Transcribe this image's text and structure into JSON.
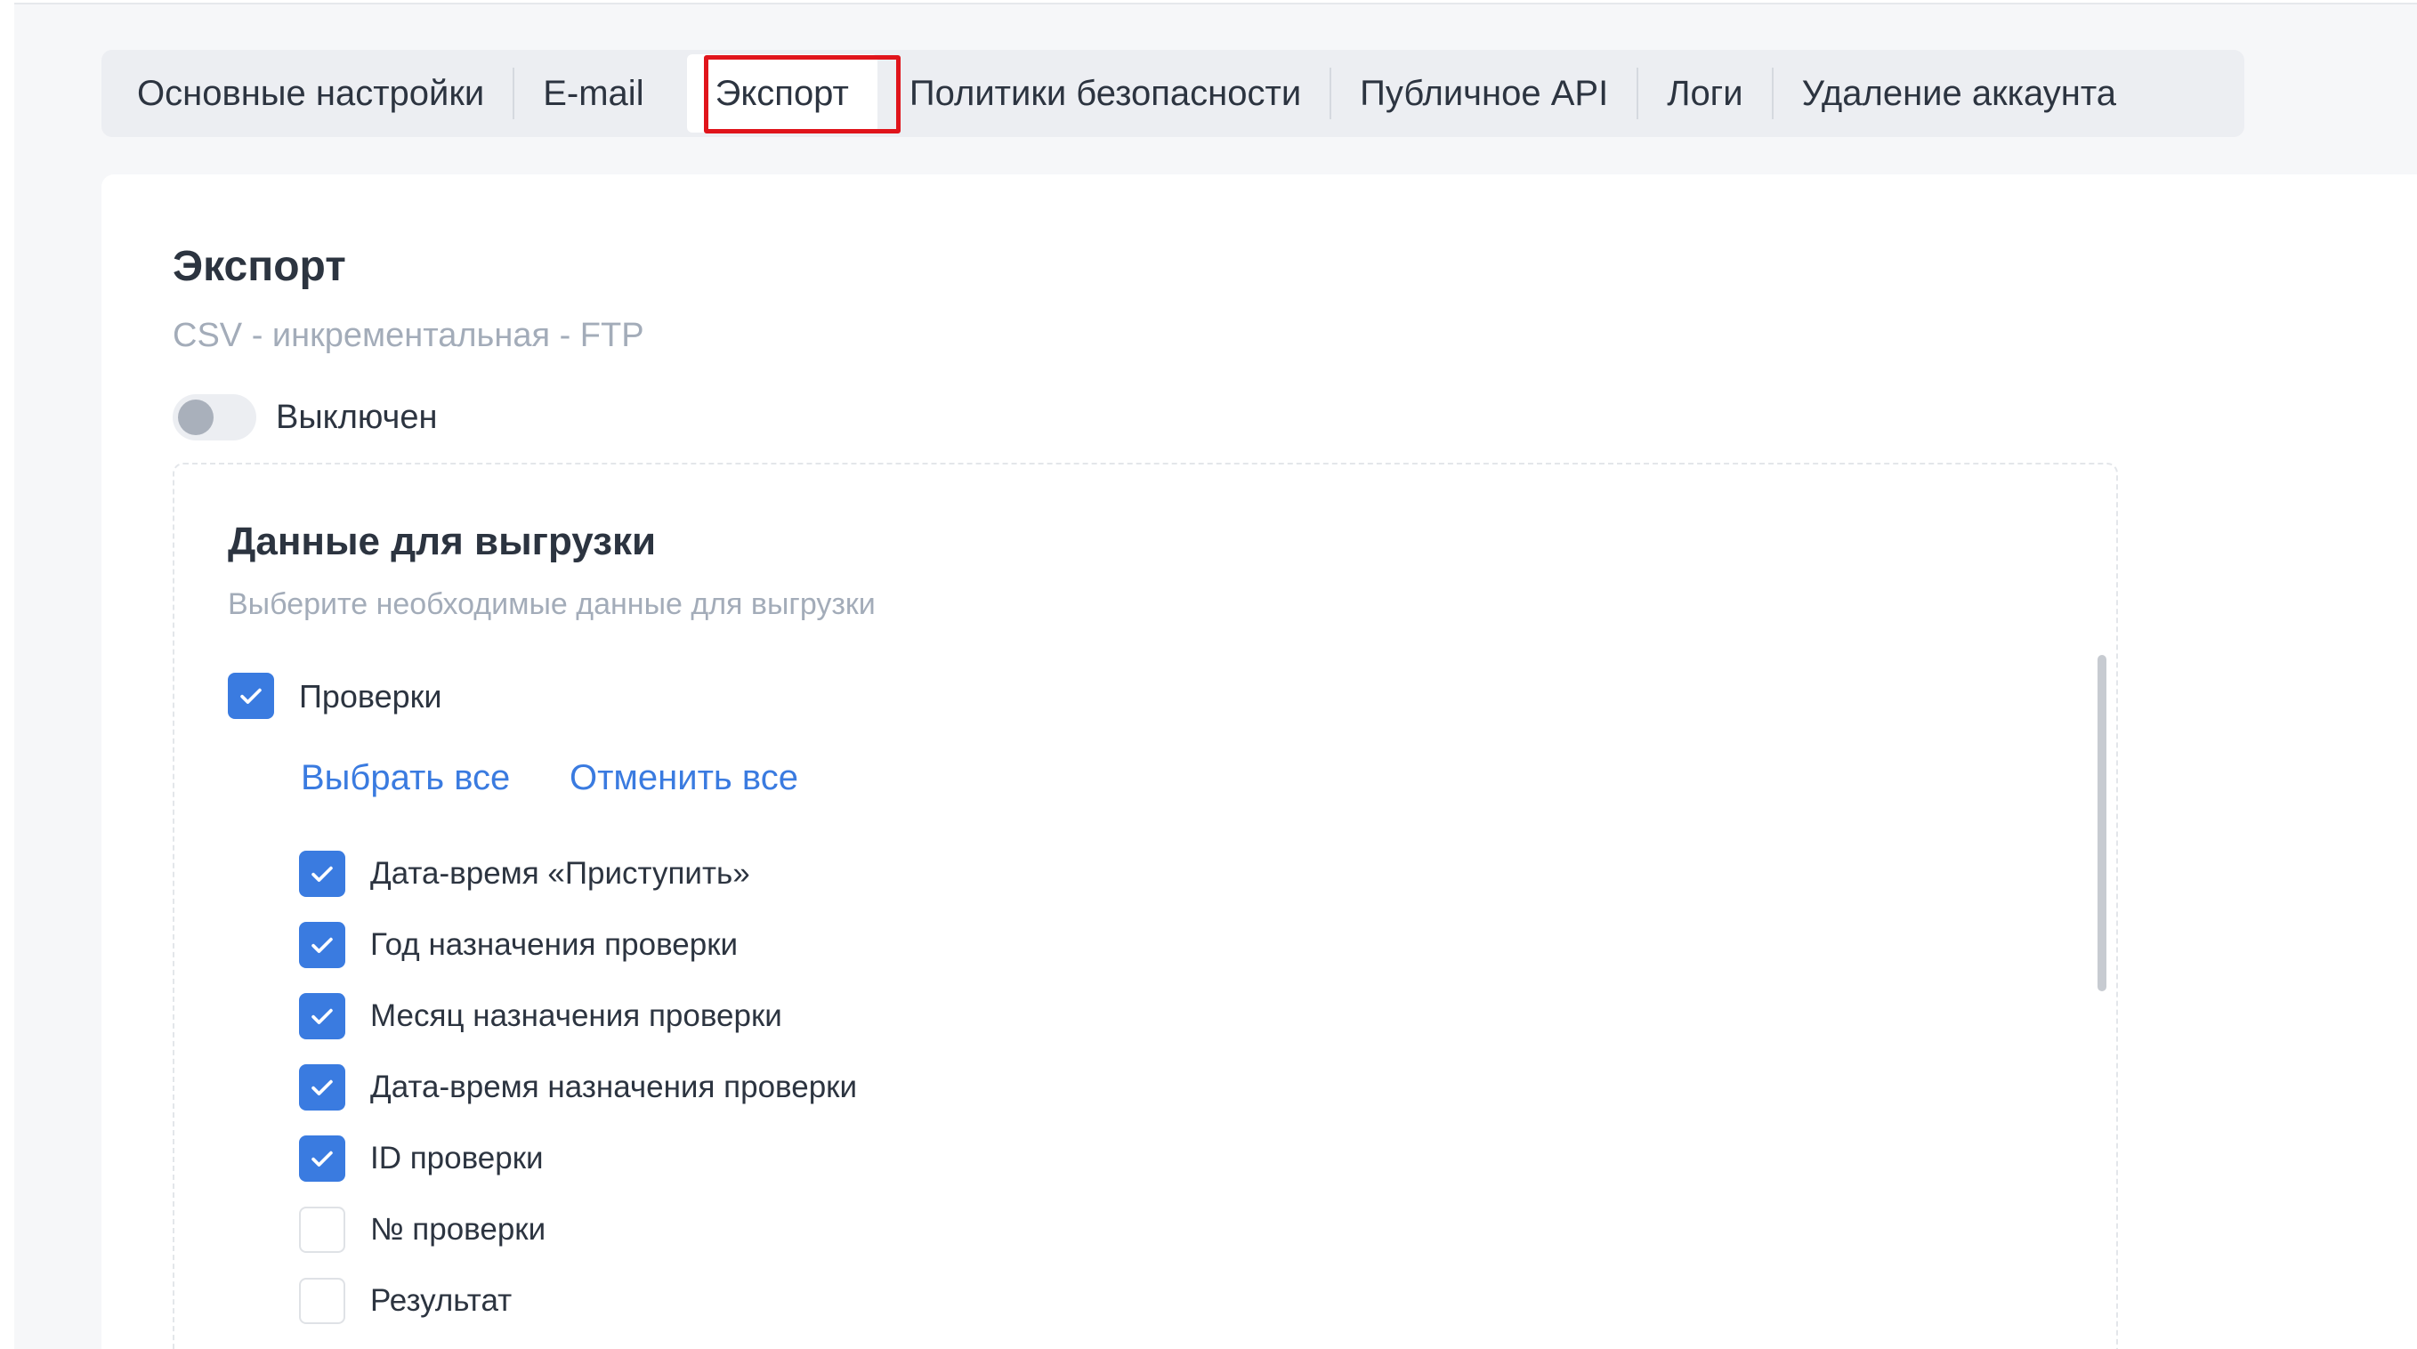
{
  "tabs": [
    {
      "label": "Основные настройки"
    },
    {
      "label": "E-mail"
    },
    {
      "label": "Экспорт"
    },
    {
      "label": "Политики безопасности"
    },
    {
      "label": "Публичное API"
    },
    {
      "label": "Логи"
    },
    {
      "label": "Удаление аккаунта"
    }
  ],
  "active_tab": "Экспорт",
  "export": {
    "title": "Экспорт",
    "subtitle": "CSV - инкрементальная - FTP",
    "toggle_label": "Выключен",
    "toggle_on": false
  },
  "data_section": {
    "title": "Данные для выгрузки",
    "subtitle": "Выберите необходимые данные для выгрузки",
    "group_label": "Проверки",
    "group_checked": true,
    "select_all": "Выбрать все",
    "deselect_all": "Отменить все",
    "fields": [
      {
        "label": "Дата-время «Приступить»",
        "checked": true
      },
      {
        "label": "Год назначения проверки",
        "checked": true
      },
      {
        "label": "Месяц назначения проверки",
        "checked": true
      },
      {
        "label": "Дата-время назначения проверки",
        "checked": true
      },
      {
        "label": "ID проверки",
        "checked": true
      },
      {
        "label": "№ проверки",
        "checked": false
      },
      {
        "label": "Результат",
        "checked": false
      }
    ]
  },
  "colors": {
    "accent": "#3a7be0",
    "highlight": "#e0141b",
    "muted_text": "#a3acb9"
  }
}
